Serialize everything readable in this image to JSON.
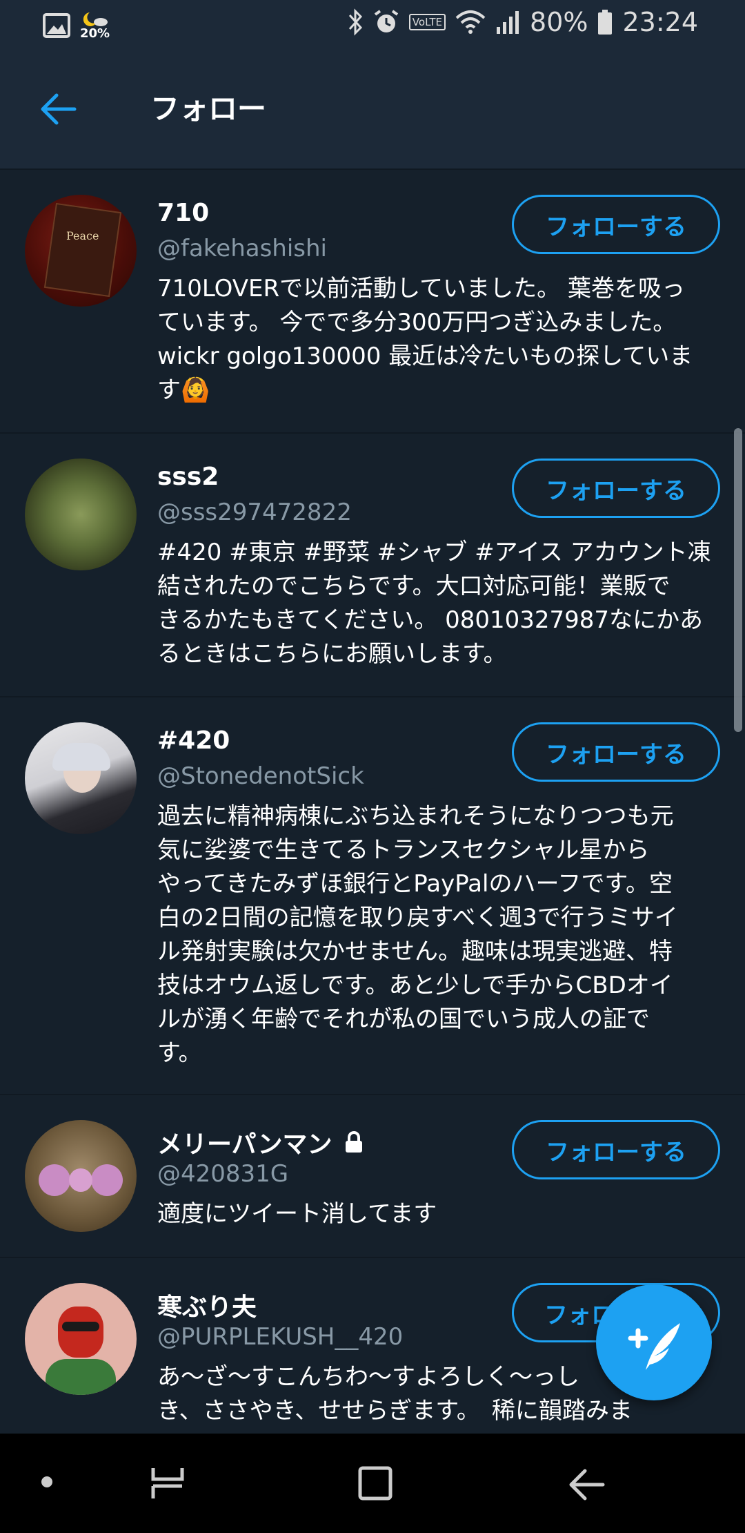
{
  "status_bar": {
    "weather_percent": "20%",
    "battery": "80%",
    "time": "23:24",
    "volte": "VoLTE",
    "icons": [
      "image-icon",
      "weather-icon",
      "bluetooth-icon",
      "alarm-icon",
      "volte-icon",
      "wifi-icon",
      "signal-icon",
      "battery-icon"
    ]
  },
  "header": {
    "title": "フォロー",
    "back_icon": "back-arrow-icon"
  },
  "users": [
    {
      "name": "710",
      "handle": "@fakehashishi",
      "bio_lines": [
        "710LOVERで以前活動していました。 葉巻を吸っ",
        "ています。 今でで多分300万円つぎ込みました。",
        "wickr golgo130000 最近は冷たいもの探していま",
        "す🙆"
      ],
      "follow_label": "フォローする",
      "avatar_text": "Peace"
    },
    {
      "name": "sss2",
      "handle": "@sss297472822",
      "bio_lines": [
        "#420 #東京 #野菜 #シャブ #アイス アカウント凍",
        "結されたのでこちらです。大口対応可能！業販で",
        "きるかたもきてください。 08010327987なにかあ",
        "るときはこちらにお願いします。"
      ],
      "follow_label": "フォローする"
    },
    {
      "name": "#420",
      "handle": "@StonedenotSick",
      "bio_lines": [
        "過去に精神病棟にぶち込まれそうになりつつも元",
        "気に娑婆で生きてるトランスセクシャル星から",
        "やってきたみずほ銀行とPayPalのハーフです。空",
        "白の2日間の記憶を取り戻すべく週3で行うミサイ",
        "ル発射実験は欠かせません。趣味は現実逃避、特",
        "技はオウム返しです。あと少しで手からCBDオイ",
        "ルが湧く年齢でそれが私の国でいう成人の証で",
        "す。"
      ],
      "follow_label": "フォローする"
    },
    {
      "name": "メリーパンマン",
      "handle": "@420831G",
      "bio_lines": [
        "適度にツイート消してます"
      ],
      "follow_label": "フォローする",
      "locked": true
    },
    {
      "name": "寒ぶり夫",
      "handle": "@PURPLEKUSH__420",
      "bio_lines": [
        "あ〜ざ〜すこんちわ〜すよろしく〜っし",
        "き、ささやき、せせらぎます。　稀に韻踏みま"
      ],
      "follow_label": "フォロ"
    }
  ],
  "fab": {
    "icon": "compose-tweet-icon"
  },
  "nav": {
    "icons": [
      "recents-dot-icon",
      "recent-apps-icon",
      "home-icon",
      "back-icon"
    ]
  },
  "colors": {
    "accent": "#1da1f2",
    "background": "#15202b",
    "header": "#1c2938",
    "secondary_text": "#8899a6"
  }
}
